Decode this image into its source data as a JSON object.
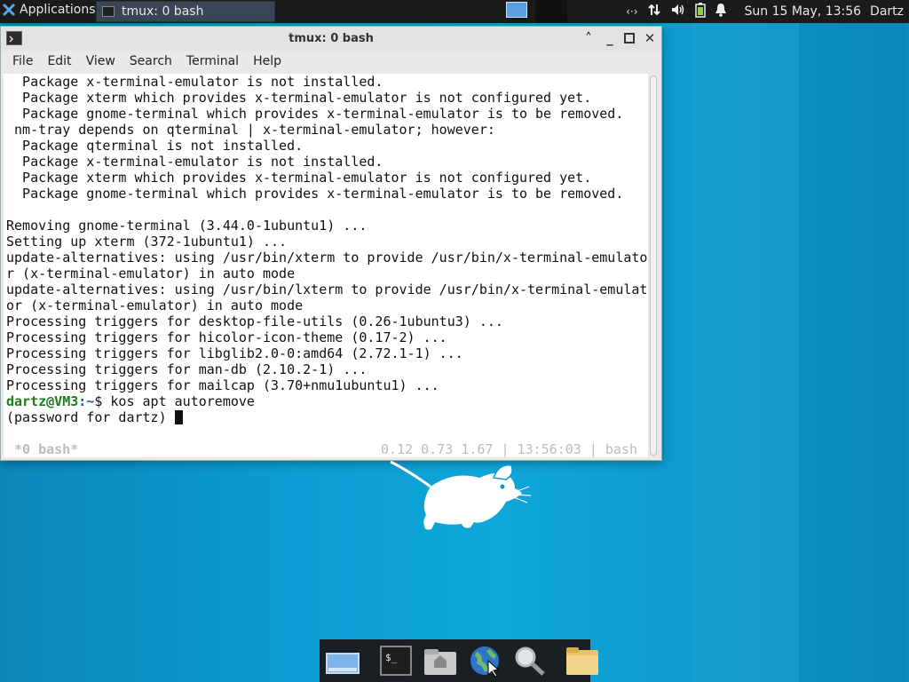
{
  "panel": {
    "applications_label": "Applications",
    "menu_indicator": "≡",
    "task_label": "tmux: 0 bash",
    "clock": "Sun 15 May, 13:56",
    "user": "Dartz"
  },
  "window": {
    "title": "tmux: 0 bash",
    "menu": [
      "File",
      "Edit",
      "View",
      "Search",
      "Terminal",
      "Help"
    ]
  },
  "terminal": {
    "lines": [
      "  Package x-terminal-emulator is not installed.",
      "  Package xterm which provides x-terminal-emulator is not configured yet.",
      "  Package gnome-terminal which provides x-terminal-emulator is to be removed.",
      " nm-tray depends on qterminal | x-terminal-emulator; however:",
      "  Package qterminal is not installed.",
      "  Package x-terminal-emulator is not installed.",
      "  Package xterm which provides x-terminal-emulator is not configured yet.",
      "  Package gnome-terminal which provides x-terminal-emulator is to be removed.",
      "",
      "Removing gnome-terminal (3.44.0-1ubuntu1) ...",
      "Setting up xterm (372-1ubuntu1) ...",
      "update-alternatives: using /usr/bin/xterm to provide /usr/bin/x-terminal-emulato",
      "r (x-terminal-emulator) in auto mode",
      "update-alternatives: using /usr/bin/lxterm to provide /usr/bin/x-terminal-emulat",
      "or (x-terminal-emulator) in auto mode",
      "Processing triggers for desktop-file-utils (0.26-1ubuntu3) ...",
      "Processing triggers for hicolor-icon-theme (0.17-2) ...",
      "Processing triggers for libglib2.0-0:amd64 (2.72.1-1) ...",
      "Processing triggers for man-db (2.10.2-1) ...",
      "Processing triggers for mailcap (3.70+nmu1ubuntu1) ..."
    ],
    "prompt_user": "dartz@VM3",
    "prompt_path": ":~",
    "prompt_symbol": "$ ",
    "command": "kos apt autoremove",
    "password_prompt": "(password for dartz) ",
    "status_left": "*0 bash*",
    "status_right": "0.12 0.73 1.67 | 13:56:03 | bash"
  },
  "colors": {
    "prompt_user": "#1a7f1a",
    "prompt_path": "#2255cc",
    "desktop": "#0a9bd1"
  },
  "icons": [
    "xfce-mouse-icon",
    "terminal-icon",
    "network-icon",
    "volume-icon",
    "battery-icon",
    "notification-icon",
    "show-desktop-icon",
    "home-folder-icon",
    "web-browser-icon",
    "search-icon",
    "files-icon"
  ]
}
